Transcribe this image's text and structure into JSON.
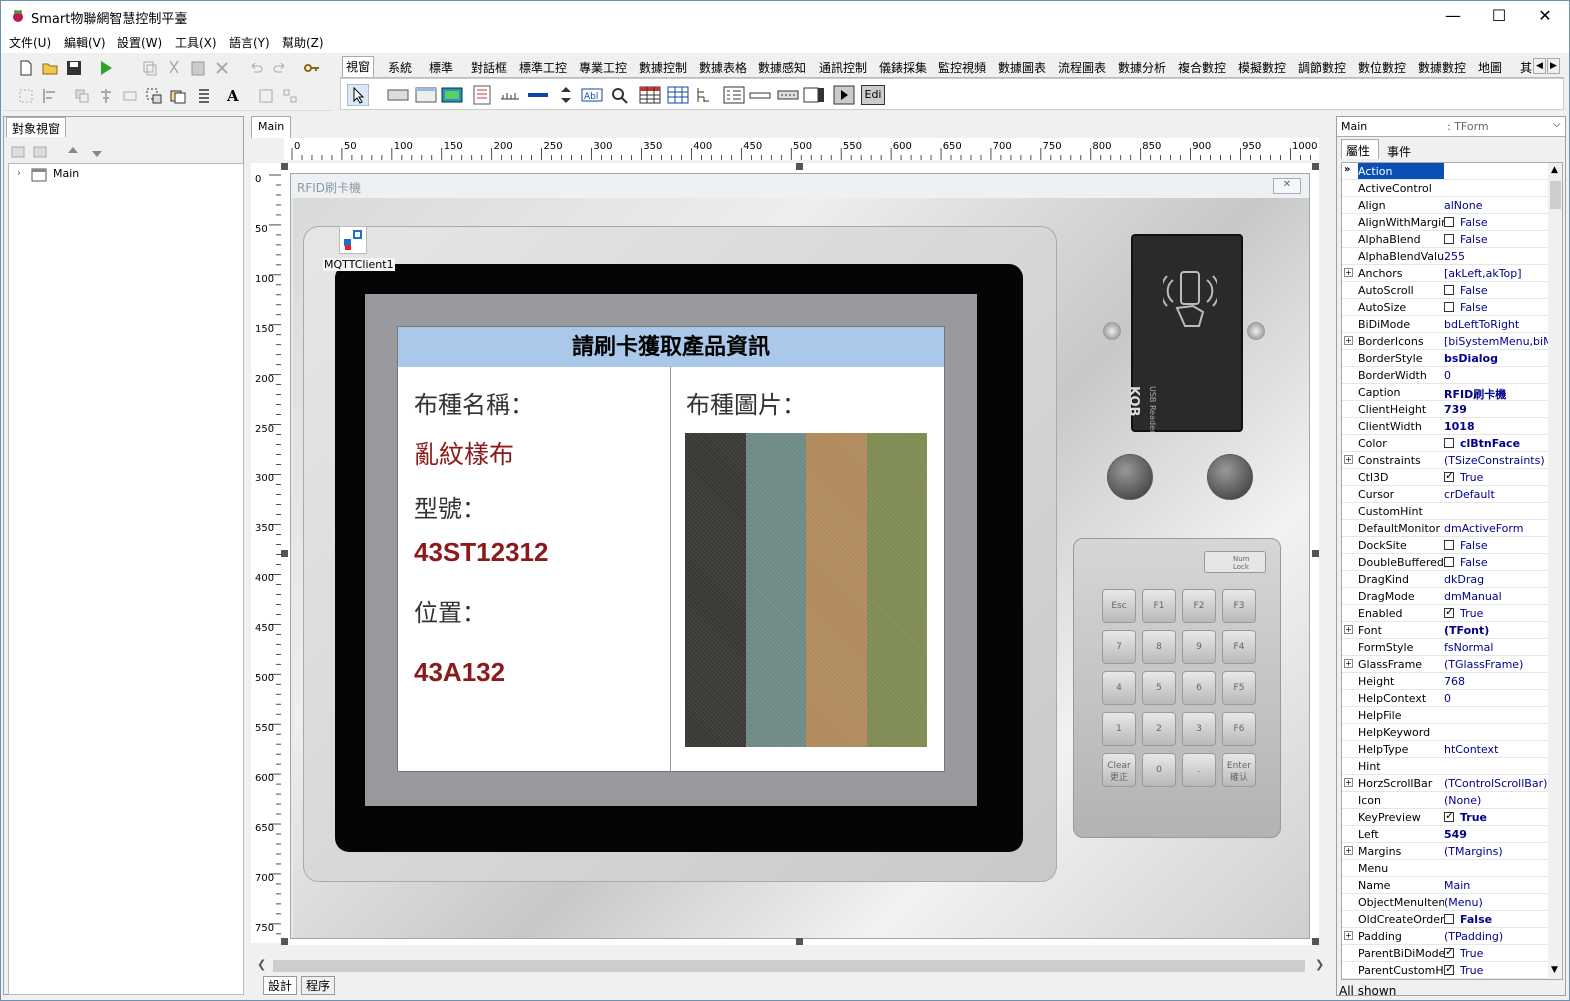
{
  "window": {
    "title": "Smart物聯網智慧控制平臺",
    "min": "—",
    "max": "☐",
    "close": "✕"
  },
  "menu": [
    "文件(U)",
    "編輯(V)",
    "設置(W)",
    "工具(X)",
    "語言(Y)",
    "幫助(Z)"
  ],
  "palette_tabs": [
    "視窗",
    "系統",
    "標準",
    "對話框",
    "標準工控",
    "專業工控",
    "數據控制",
    "數據表格",
    "數據感知",
    "通訊控制",
    "儀錶採集",
    "監控視頻",
    "數據圖表",
    "流程圖表",
    "數據分析",
    "複合數控",
    "模擬數控",
    "調節數控",
    "數位數控",
    "數據數控",
    "地圖",
    "其"
  ],
  "palette_edit_label": "Edi",
  "object_panel": {
    "tab": "對象視窗",
    "tree_root": "Main"
  },
  "design_tab": "Main",
  "bottom_tabs": [
    "設計",
    "程序"
  ],
  "ruler_h": [
    "0",
    "50",
    "100",
    "150",
    "200",
    "250",
    "300",
    "350",
    "400",
    "450",
    "500",
    "550",
    "600",
    "650",
    "700",
    "750",
    "800",
    "850",
    "900",
    "950",
    "1000"
  ],
  "ruler_v": [
    "0",
    "50",
    "100",
    "150",
    "200",
    "250",
    "300",
    "350",
    "400",
    "450",
    "500",
    "550",
    "600",
    "650",
    "700",
    "750"
  ],
  "form": {
    "caption": "RFID刷卡機",
    "close_glyph": "✕",
    "mqtt_label": "MQTTClient1",
    "screen": {
      "header": "請刷卡獲取產品資訊",
      "label_name": "布種名稱：",
      "value_name": "亂紋樣布",
      "label_model": "型號：",
      "value_model": "43ST12312",
      "label_location": "位置：",
      "value_location": "43A132",
      "label_image": "布種圖片：",
      "fabric_colors": [
        "#3a3835",
        "#6f8a84",
        "#b08a5c",
        "#7f8b52"
      ]
    },
    "reader": {
      "brand": "KOB",
      "subtitle": "USB Reader"
    },
    "keypad": {
      "numlock": "Num Lock",
      "keys": [
        "Esc",
        "F1",
        "F2",
        "F3",
        "7",
        "8",
        "9",
        "F4",
        "4",
        "5",
        "6",
        "F5",
        "1",
        "2",
        "3",
        "F6",
        "Clear 更正",
        "0",
        ".",
        "Enter 確认"
      ]
    }
  },
  "inspector": {
    "object_name": "Main",
    "object_type": ": TForm",
    "tabs": [
      "屬性",
      "事件"
    ],
    "status": "All shown",
    "props": [
      {
        "n": "Action",
        "v": "",
        "sel": true
      },
      {
        "n": "ActiveControl",
        "v": ""
      },
      {
        "n": "Align",
        "v": "alNone"
      },
      {
        "n": "AlignWithMargins",
        "v": "False",
        "chk": false
      },
      {
        "n": "AlphaBlend",
        "v": "False",
        "chk": false
      },
      {
        "n": "AlphaBlendValue",
        "v": "255"
      },
      {
        "n": "Anchors",
        "v": "[akLeft,akTop]",
        "exp": true
      },
      {
        "n": "AutoScroll",
        "v": "False",
        "chk": false
      },
      {
        "n": "AutoSize",
        "v": "False",
        "chk": false
      },
      {
        "n": "BiDiMode",
        "v": "bdLeftToRight"
      },
      {
        "n": "BorderIcons",
        "v": "[biSystemMenu,biMini",
        "exp": true
      },
      {
        "n": "BorderStyle",
        "v": "bsDialog",
        "b": true
      },
      {
        "n": "BorderWidth",
        "v": "0"
      },
      {
        "n": "Caption",
        "v": "RFID刷卡機",
        "b": true
      },
      {
        "n": "ClientHeight",
        "v": "739",
        "b": true
      },
      {
        "n": "ClientWidth",
        "v": "1018",
        "b": true
      },
      {
        "n": "Color",
        "v": "clBtnFace",
        "b": true,
        "sw": true
      },
      {
        "n": "Constraints",
        "v": "(TSizeConstraints)",
        "exp": true
      },
      {
        "n": "Ctl3D",
        "v": "True",
        "chk": true
      },
      {
        "n": "Cursor",
        "v": "crDefault"
      },
      {
        "n": "CustomHint",
        "v": ""
      },
      {
        "n": "DefaultMonitor",
        "v": "dmActiveForm"
      },
      {
        "n": "DockSite",
        "v": "False",
        "chk": false
      },
      {
        "n": "DoubleBuffered",
        "v": "False",
        "chk": false
      },
      {
        "n": "DragKind",
        "v": "dkDrag"
      },
      {
        "n": "DragMode",
        "v": "dmManual"
      },
      {
        "n": "Enabled",
        "v": "True",
        "chk": true
      },
      {
        "n": "Font",
        "v": "(TFont)",
        "b": true,
        "exp": true
      },
      {
        "n": "FormStyle",
        "v": "fsNormal"
      },
      {
        "n": "GlassFrame",
        "v": "(TGlassFrame)",
        "exp": true
      },
      {
        "n": "Height",
        "v": "768"
      },
      {
        "n": "HelpContext",
        "v": "0"
      },
      {
        "n": "HelpFile",
        "v": ""
      },
      {
        "n": "HelpKeyword",
        "v": ""
      },
      {
        "n": "HelpType",
        "v": "htContext"
      },
      {
        "n": "Hint",
        "v": ""
      },
      {
        "n": "HorzScrollBar",
        "v": "(TControlScrollBar)",
        "exp": true
      },
      {
        "n": "Icon",
        "v": "(None)"
      },
      {
        "n": "KeyPreview",
        "v": "True",
        "chk": true,
        "b": true
      },
      {
        "n": "Left",
        "v": "549",
        "b": true
      },
      {
        "n": "Margins",
        "v": "(TMargins)",
        "exp": true
      },
      {
        "n": "Menu",
        "v": ""
      },
      {
        "n": "Name",
        "v": "Main"
      },
      {
        "n": "ObjectMenuItem",
        "v": "(Menu)"
      },
      {
        "n": "OldCreateOrder",
        "v": "False",
        "chk": false,
        "b": true
      },
      {
        "n": "Padding",
        "v": "(TPadding)",
        "exp": true
      },
      {
        "n": "ParentBiDiMode",
        "v": "True",
        "chk": true
      },
      {
        "n": "ParentCustomHin",
        "v": "True",
        "chk": true
      }
    ]
  }
}
